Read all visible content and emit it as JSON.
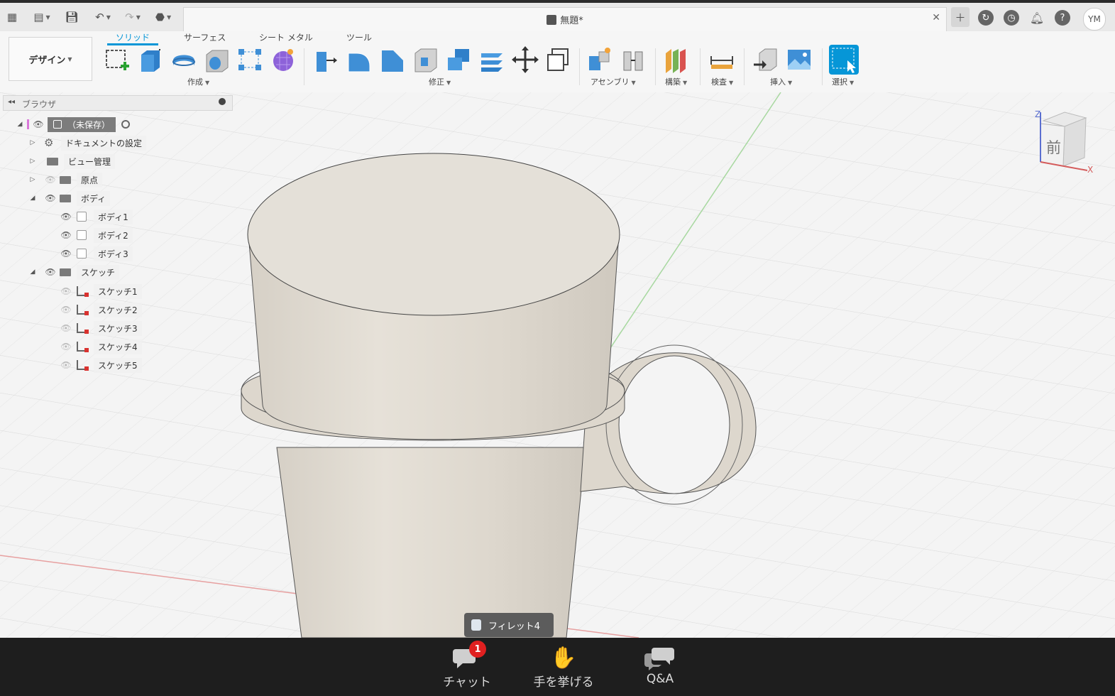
{
  "app": {
    "document_title": "無題*",
    "user_initials": "YM"
  },
  "ribbon": {
    "workspace_label": "デザイン",
    "tabs": [
      "ソリッド",
      "サーフェス",
      "シート メタル",
      "ツール"
    ],
    "groups": {
      "create": "作成",
      "modify": "修正",
      "assembly": "アセンブリ",
      "construct": "構築",
      "inspect": "検査",
      "insert": "挿入",
      "select": "選択"
    }
  },
  "browser": {
    "title": "ブラウザ",
    "root": "（未保存）",
    "items": {
      "doc_settings": "ドキュメントの設定",
      "named_views": "ビュー管理",
      "origin": "原点",
      "bodies": "ボディ",
      "body1": "ボディ1",
      "body2": "ボディ2",
      "body3": "ボディ3",
      "sketches": "スケッチ",
      "sketch1": "スケッチ1",
      "sketch2": "スケッチ2",
      "sketch3": "スケッチ3",
      "sketch4": "スケッチ4",
      "sketch5": "スケッチ5"
    }
  },
  "viewcube": {
    "face": "前",
    "axis_z": "Z",
    "axis_x": "X"
  },
  "tooltip": {
    "label": "フィレット4"
  },
  "meeting": {
    "chat_label": "チャット",
    "chat_badge": "1",
    "raise_hand_label": "手を挙げる",
    "qa_label": "Q&A"
  },
  "colors": {
    "accent": "#0696d7",
    "model_body": "#ddd8cf",
    "badge": "#e02020"
  }
}
